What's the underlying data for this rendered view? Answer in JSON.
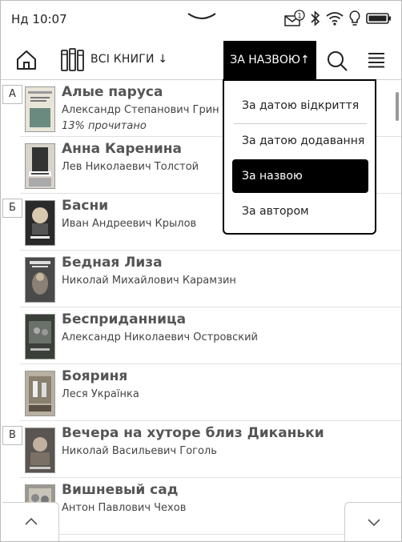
{
  "status": {
    "time": "Нд 10:07",
    "icons": [
      "mail-notification-icon",
      "bluetooth-icon",
      "wifi-icon",
      "frontlight-icon",
      "battery-icon"
    ],
    "notification_count": "1"
  },
  "toolbar": {
    "all_books": "ВСІ КНИГИ ↓",
    "sort": "ЗА НАЗВОЮ↑"
  },
  "sort_menu": {
    "items": [
      {
        "label": "За датою відкриття",
        "selected": false
      },
      {
        "label": "За датою додавання",
        "selected": false
      },
      {
        "label": "За назвою",
        "selected": true
      },
      {
        "label": "За автором",
        "selected": false
      }
    ]
  },
  "books": [
    {
      "letter": "А",
      "title": "Алые паруса",
      "author": "Александр Степанович Грин",
      "progress": "13% прочитано",
      "cover_color": "#e8e4d8"
    },
    {
      "letter": "",
      "title": "Анна Каренина",
      "author": "Лев Николаевич Толстой",
      "progress": "",
      "cover_color": "#d8d4cc"
    },
    {
      "letter": "Б",
      "title": "Басни",
      "author": "Иван Андреевич Крылов",
      "progress": "",
      "cover_color": "#2a2a2a"
    },
    {
      "letter": "",
      "title": "Бедная Лиза",
      "author": "Николай Михайлович Карамзин",
      "progress": "",
      "cover_color": "#4a4a4a"
    },
    {
      "letter": "",
      "title": "Бесприданница",
      "author": "Александр Николаевич Островский",
      "progress": "",
      "cover_color": "#3a3f3a"
    },
    {
      "letter": "",
      "title": "Бояриня",
      "author": "Леся Українка",
      "progress": "",
      "cover_color": "#b8b0a0"
    },
    {
      "letter": "В",
      "title": "Вечера на хуторе близ Диканьки",
      "author": "Николай Васильевич Гоголь",
      "progress": "",
      "cover_color": "#5a5550"
    },
    {
      "letter": "",
      "title": "Вишневый сад",
      "author": "Антон Павлович Чехов",
      "progress": "",
      "cover_color": "#9a9890"
    }
  ]
}
